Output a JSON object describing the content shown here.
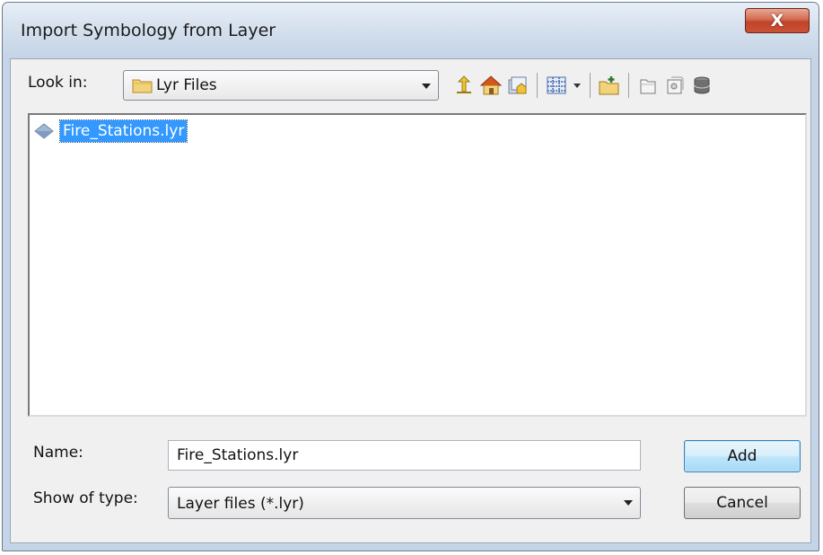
{
  "window": {
    "title": "Import Symbology from Layer",
    "close_label": "X"
  },
  "lookin": {
    "label": "Look in:",
    "value": "Lyr Files",
    "icon": "folder-icon"
  },
  "toolbar": {
    "icons": [
      "up-one-level-icon",
      "home-icon",
      "catalog-connect-icon",
      "view-menu-icon",
      "new-folder-icon",
      "new-file-icon",
      "new-layer-icon",
      "geodatabase-icon"
    ]
  },
  "files": [
    {
      "name": "Fire_Stations.lyr",
      "icon": "layer-file-icon",
      "selected": true
    }
  ],
  "name_field": {
    "label": "Name:",
    "value": "Fire_Stations.lyr"
  },
  "type_field": {
    "label": "Show of type:",
    "value": "Layer files (*.lyr)"
  },
  "buttons": {
    "add": "Add",
    "cancel": "Cancel"
  },
  "colors": {
    "selection": "#3399ff",
    "close": "#c0432a",
    "default_button": "#bee6fd"
  }
}
